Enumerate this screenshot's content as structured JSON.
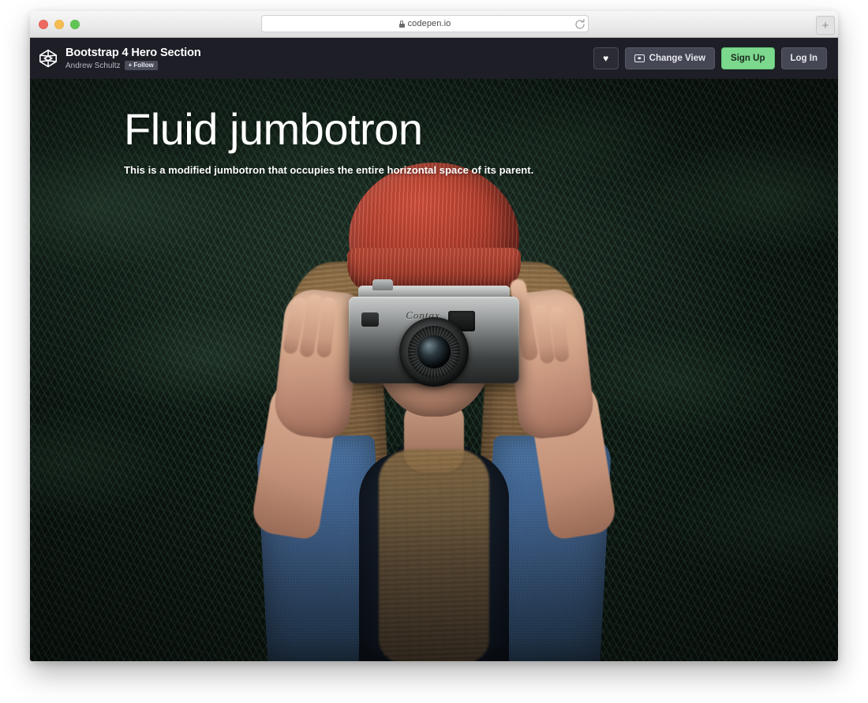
{
  "browser": {
    "url": "codepen.io",
    "secure_icon": "lock-icon",
    "reload_icon": "reload-icon",
    "page_info_icon": "page-info-icon",
    "new_tab_label": "+",
    "traffic_lights": [
      {
        "name": "close",
        "color": "#ec6a5f"
      },
      {
        "name": "minimize",
        "color": "#f5bd4f"
      },
      {
        "name": "maximize",
        "color": "#61c555"
      }
    ]
  },
  "codepen_nav": {
    "logo_icon": "codepen-logo-icon",
    "pen_title": "Bootstrap 4 Hero Section",
    "author": "Andrew Schultz",
    "follow_label": "+ Follow",
    "actions": {
      "heart_label": "♥",
      "change_view_label": "Change View",
      "change_view_icon": "view-screen-icon",
      "sign_up_label": "Sign Up",
      "log_in_label": "Log In"
    },
    "colors": {
      "nav_background": "#1d1e26",
      "button_background": "#454754",
      "signup_background": "#7bd88c",
      "heart_background": "#2a2b33"
    }
  },
  "hero": {
    "title": "Fluid jumbotron",
    "subtitle": "This is a modified jumbotron that occupies the entire horizontal space of its parent.",
    "photo": {
      "description": "Woman in red knit beanie and denim shirt holding a vintage rangefinder camera to her face, dark evergreen forest background",
      "camera_brand": "Contax",
      "beanie_color": "#bf4331",
      "denim_color": "#3d6596",
      "foliage_color": "#16261d"
    }
  }
}
